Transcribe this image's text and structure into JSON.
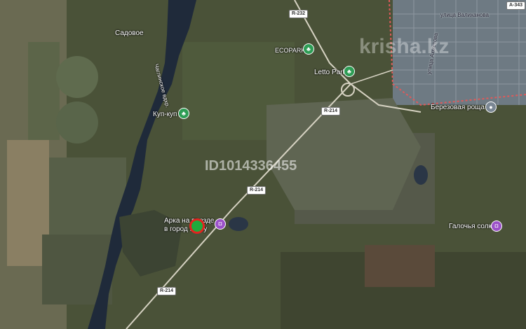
{
  "places": {
    "sadovoe": "Садовое",
    "reservoir": "Чаглинское вдхр.",
    "ecopark": "ECOPARK",
    "letto_park": "Letto Park",
    "kup_kup": "Куп-куп",
    "berezovaya_roshcha": "Березовая роща",
    "arka": "Арка на въезде в город Ко...у",
    "galochya_solka": "Галочья солка",
    "ulitsa_valikhanova": "улица Валиханова",
    "ulitsa_akhmetova": "улица Ахметова"
  },
  "roads": {
    "r232": "R-232",
    "r214_a": "R-214",
    "r214_b": "R-214",
    "r214_c": "R-214",
    "a343": "A-343"
  },
  "watermark": {
    "site": "krisha.kz",
    "listing_id": "ID1014336455"
  },
  "colors": {
    "marker_fill": "#1faa3c",
    "marker_ring": "#e3231f",
    "city_boundary": "#e05a5a",
    "poi_green": "#2e9d55",
    "poi_purple": "#9b51c8"
  }
}
